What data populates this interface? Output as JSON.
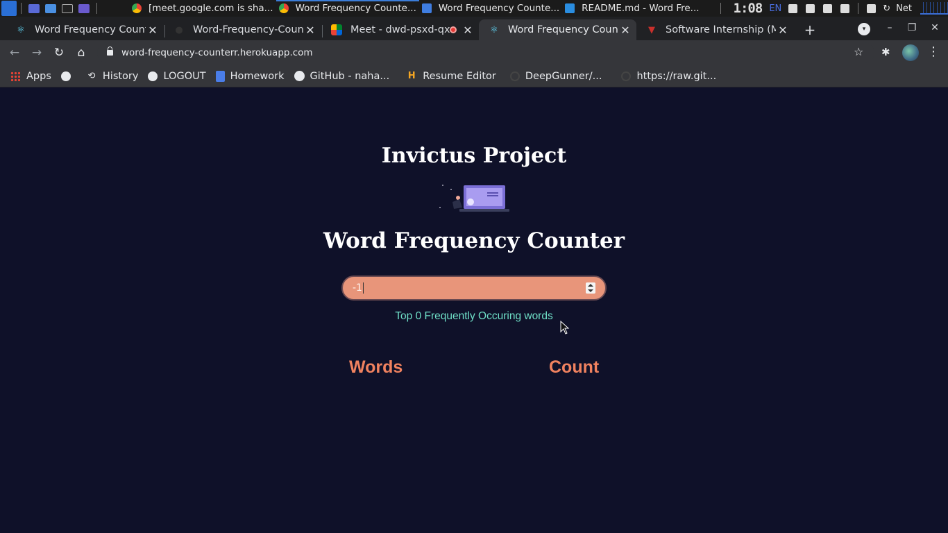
{
  "os_panel": {
    "tasks": [
      {
        "label": "[meet.google.com is sha..."
      },
      {
        "label": "Word Frequency Counte..."
      },
      {
        "label": "Word Frequency Counte..."
      },
      {
        "label": "README.md - Word Fre..."
      }
    ],
    "clock": "1:08",
    "lang": "EN",
    "net_label": "Net"
  },
  "browser": {
    "tabs": [
      {
        "title": "Word Frequency Counter",
        "icon": "react-icon"
      },
      {
        "title": "Word-Frequency-Counter",
        "icon": "github-icon"
      },
      {
        "title": "Meet - dwd-psxd-qxf",
        "icon": "meet-icon"
      },
      {
        "title": "Word Frequency Counter",
        "icon": "react-icon"
      },
      {
        "title": "Software Internship (MERN",
        "icon": "internshala-icon"
      }
    ],
    "active_tab": 3,
    "url": "word-frequency-counterr.herokuapp.com",
    "bookmarks": [
      {
        "label": "Apps",
        "icon": "apps-grid-icon"
      },
      {
        "label": "",
        "icon": "globe-icon"
      },
      {
        "label": "History",
        "icon": "history-icon"
      },
      {
        "label": "LOGOUT",
        "icon": "globe-icon"
      },
      {
        "label": "Homework",
        "icon": "docs-icon"
      },
      {
        "label": "GitHub - naha...",
        "icon": "github-icon"
      },
      {
        "label": "Resume Editor",
        "icon": "hackerrank-icon"
      },
      {
        "label": "DeepGunner/...",
        "icon": "github-icon"
      },
      {
        "label": "https://raw.git...",
        "icon": "loading-icon"
      }
    ]
  },
  "page": {
    "project_title": "Invictus Project",
    "app_title": "Word Frequency Counter",
    "input_value": "-1",
    "result_text": "Top 0 Frequently Occuring words",
    "columns": [
      "Words",
      "Count"
    ]
  },
  "colors": {
    "page_bg": "#0f1129",
    "input_bg": "#e8957a",
    "accent_teal": "#6fe0c8",
    "accent_orange": "#f0825f"
  }
}
